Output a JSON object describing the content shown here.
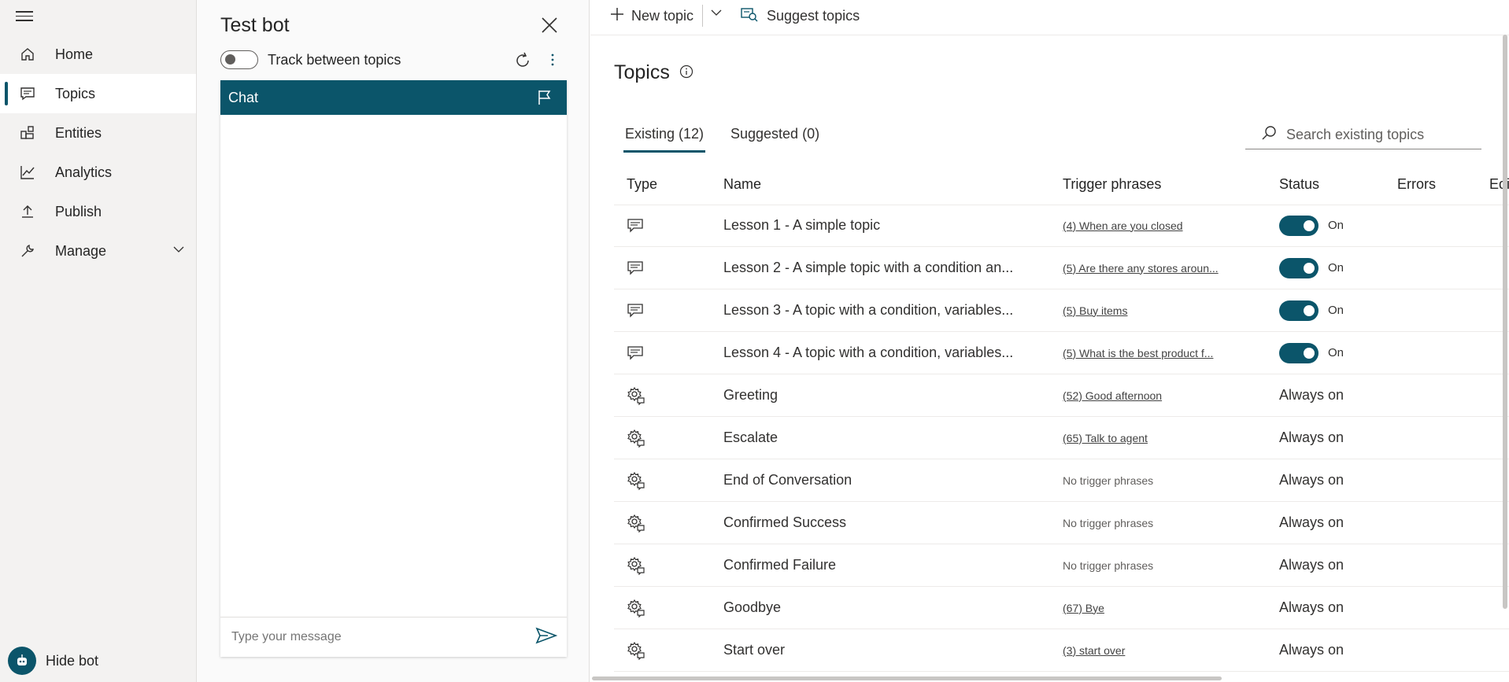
{
  "sidebar": {
    "items": [
      {
        "label": "Home",
        "icon": "home-icon"
      },
      {
        "label": "Topics",
        "icon": "chat-icon"
      },
      {
        "label": "Entities",
        "icon": "entities-icon"
      },
      {
        "label": "Analytics",
        "icon": "analytics-icon"
      },
      {
        "label": "Publish",
        "icon": "upload-icon"
      },
      {
        "label": "Manage",
        "icon": "wrench-icon"
      }
    ],
    "hide_bot": "Hide bot"
  },
  "test_panel": {
    "title": "Test bot",
    "track_label": "Track between topics",
    "chat_header": "Chat",
    "input_placeholder": "Type your message"
  },
  "toolbar": {
    "new_topic": "New topic",
    "suggest_topics": "Suggest topics"
  },
  "page": {
    "title": "Topics"
  },
  "tabs": [
    {
      "label": "Existing (12)",
      "active": true
    },
    {
      "label": "Suggested (0)",
      "active": false
    }
  ],
  "search": {
    "placeholder": "Search existing topics"
  },
  "table": {
    "headers": [
      "Type",
      "Name",
      "Trigger phrases",
      "Status",
      "Errors",
      "Editing"
    ],
    "rows": [
      {
        "type": "custom",
        "name": "Lesson 1 - A simple topic",
        "trigger": "(4) When are you closed",
        "status": "On"
      },
      {
        "type": "custom",
        "name": "Lesson 2 - A simple topic with a condition an...",
        "trigger": "(5) Are there any stores aroun...",
        "status": "On"
      },
      {
        "type": "custom",
        "name": "Lesson 3 - A topic with a condition, variables...",
        "trigger": "(5) Buy items",
        "status": "On"
      },
      {
        "type": "custom",
        "name": "Lesson 4 - A topic with a condition, variables...",
        "trigger": "(5) What is the best product f...",
        "status": "On"
      },
      {
        "type": "system",
        "name": "Greeting",
        "trigger": "(52) Good afternoon",
        "status": "Always on"
      },
      {
        "type": "system",
        "name": "Escalate",
        "trigger": "(65) Talk to agent",
        "status": "Always on"
      },
      {
        "type": "system",
        "name": "End of Conversation",
        "trigger": "No trigger phrases",
        "status": "Always on"
      },
      {
        "type": "system",
        "name": "Confirmed Success",
        "trigger": "No trigger phrases",
        "status": "Always on"
      },
      {
        "type": "system",
        "name": "Confirmed Failure",
        "trigger": "No trigger phrases",
        "status": "Always on"
      },
      {
        "type": "system",
        "name": "Goodbye",
        "trigger": "(67) Bye",
        "status": "Always on"
      },
      {
        "type": "system",
        "name": "Start over",
        "trigger": "(3) start over",
        "status": "Always on"
      }
    ]
  },
  "colors": {
    "accent": "#0b556a",
    "sidebar_bg": "#f3f2f1"
  }
}
